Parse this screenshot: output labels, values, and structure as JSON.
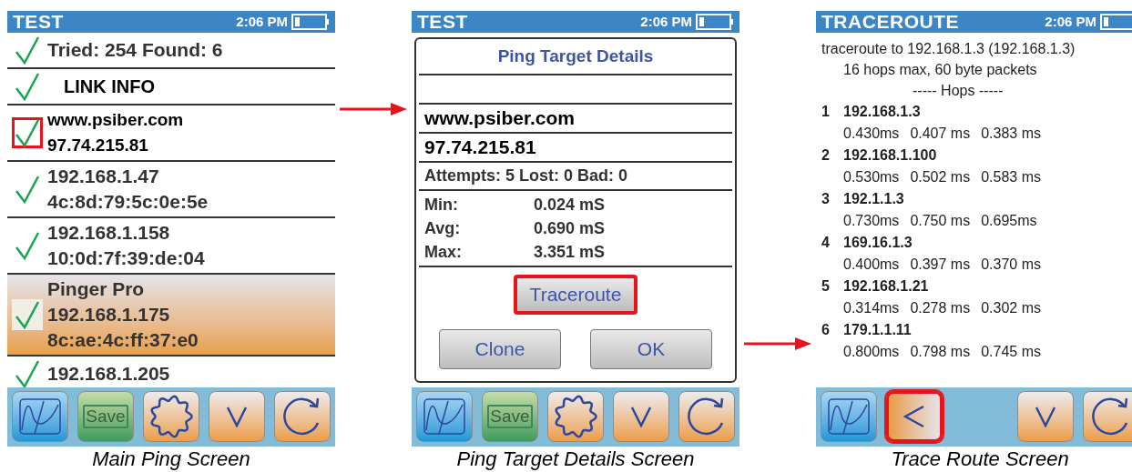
{
  "main_screen": {
    "title": "TEST",
    "time": "2:06 PM",
    "rows": [
      {
        "kind": "status",
        "lines": [
          "Tried: 254 Found: 6"
        ],
        "selected": false,
        "highlighted": false
      },
      {
        "kind": "section",
        "lines": [
          "LINK INFO"
        ],
        "selected": false,
        "highlighted": false
      },
      {
        "kind": "target",
        "lines": [
          "www.psiber.com",
          "97.74.215.81"
        ],
        "selected": false,
        "highlighted": true
      },
      {
        "kind": "host",
        "lines": [
          "192.168.1.47",
          "4c:8d:79:5c:0e:5e"
        ],
        "selected": false,
        "highlighted": false
      },
      {
        "kind": "host",
        "lines": [
          "192.168.1.158",
          "10:0d:7f:39:de:04"
        ],
        "selected": false,
        "highlighted": false
      },
      {
        "kind": "host",
        "lines": [
          "Pinger Pro",
          "192.168.1.175",
          "8c:ae:4c:ff:37:e0"
        ],
        "selected": true,
        "highlighted": false
      },
      {
        "kind": "host",
        "lines": [
          "192.168.1.205"
        ],
        "selected": false,
        "highlighted": false
      }
    ],
    "toolbar": [
      {
        "kind": "graph",
        "highlighted": false
      },
      {
        "kind": "save",
        "label": "Save",
        "highlighted": false
      },
      {
        "kind": "settings",
        "highlighted": false
      },
      {
        "kind": "down",
        "highlighted": false
      },
      {
        "kind": "refresh",
        "highlighted": false
      }
    ],
    "caption": "Main Ping Screen"
  },
  "details_screen": {
    "title": "TEST",
    "time": "2:06 PM",
    "dialog": {
      "title": "Ping Target Details",
      "host": "www.psiber.com",
      "address": "97.74.215.81",
      "summary": "Attempts: 5 Lost: 0 Bad: 0",
      "stats": [
        {
          "label": "Min:",
          "value": "0.024 mS"
        },
        {
          "label": "Avg:",
          "value": "0.690 mS"
        },
        {
          "label": "Max:",
          "value": "3.351 mS"
        }
      ],
      "buttons": [
        {
          "kind": "traceroute",
          "label": "Traceroute",
          "highlighted": true
        },
        {
          "kind": "clone",
          "label": "Clone",
          "highlighted": false
        },
        {
          "kind": "ok",
          "label": "OK",
          "highlighted": false
        }
      ]
    },
    "toolbar": [
      {
        "kind": "graph",
        "highlighted": false
      },
      {
        "kind": "save",
        "label": "Save",
        "highlighted": false
      },
      {
        "kind": "settings",
        "highlighted": false
      },
      {
        "kind": "down",
        "highlighted": false
      },
      {
        "kind": "refresh",
        "highlighted": false
      }
    ],
    "caption": "Ping Target Details Screen"
  },
  "traceroute_screen": {
    "title": "TRACEROUTE",
    "time": "2:06 PM",
    "intro": [
      "traceroute to 192.168.1.3 (192.168.1.3)",
      "16 hops max, 60 byte packets",
      "----- Hops -----"
    ],
    "hops": [
      {
        "number": "1",
        "address": "192.168.1.3",
        "times": [
          "0.430ms",
          "0.407 ms",
          "0.383 ms"
        ]
      },
      {
        "number": "2",
        "address": "192.168.1.100",
        "times": [
          "0.530ms",
          "0.502 ms",
          "0.583 ms"
        ]
      },
      {
        "number": "3",
        "address": "192.1.1.3",
        "times": [
          "0.730ms",
          "0.750 ms",
          "0.695ms"
        ]
      },
      {
        "number": "4",
        "address": "169.16.1.3",
        "times": [
          "0.400ms",
          "0.397 ms",
          "0.370 ms"
        ]
      },
      {
        "number": "5",
        "address": "192.168.1.21",
        "times": [
          "0.314ms",
          "0.278 ms",
          "0.302 ms"
        ]
      },
      {
        "number": "6",
        "address": "179.1.1.11",
        "times": [
          "0.800ms",
          "0.798 ms",
          "0.745 ms"
        ]
      }
    ],
    "toolbar": [
      {
        "kind": "graph",
        "highlighted": false
      },
      {
        "kind": "back",
        "highlighted": true
      },
      {
        "kind": "empty"
      },
      {
        "kind": "down",
        "highlighted": false
      },
      {
        "kind": "refresh",
        "highlighted": false
      }
    ],
    "caption": "Trace Route Screen"
  }
}
